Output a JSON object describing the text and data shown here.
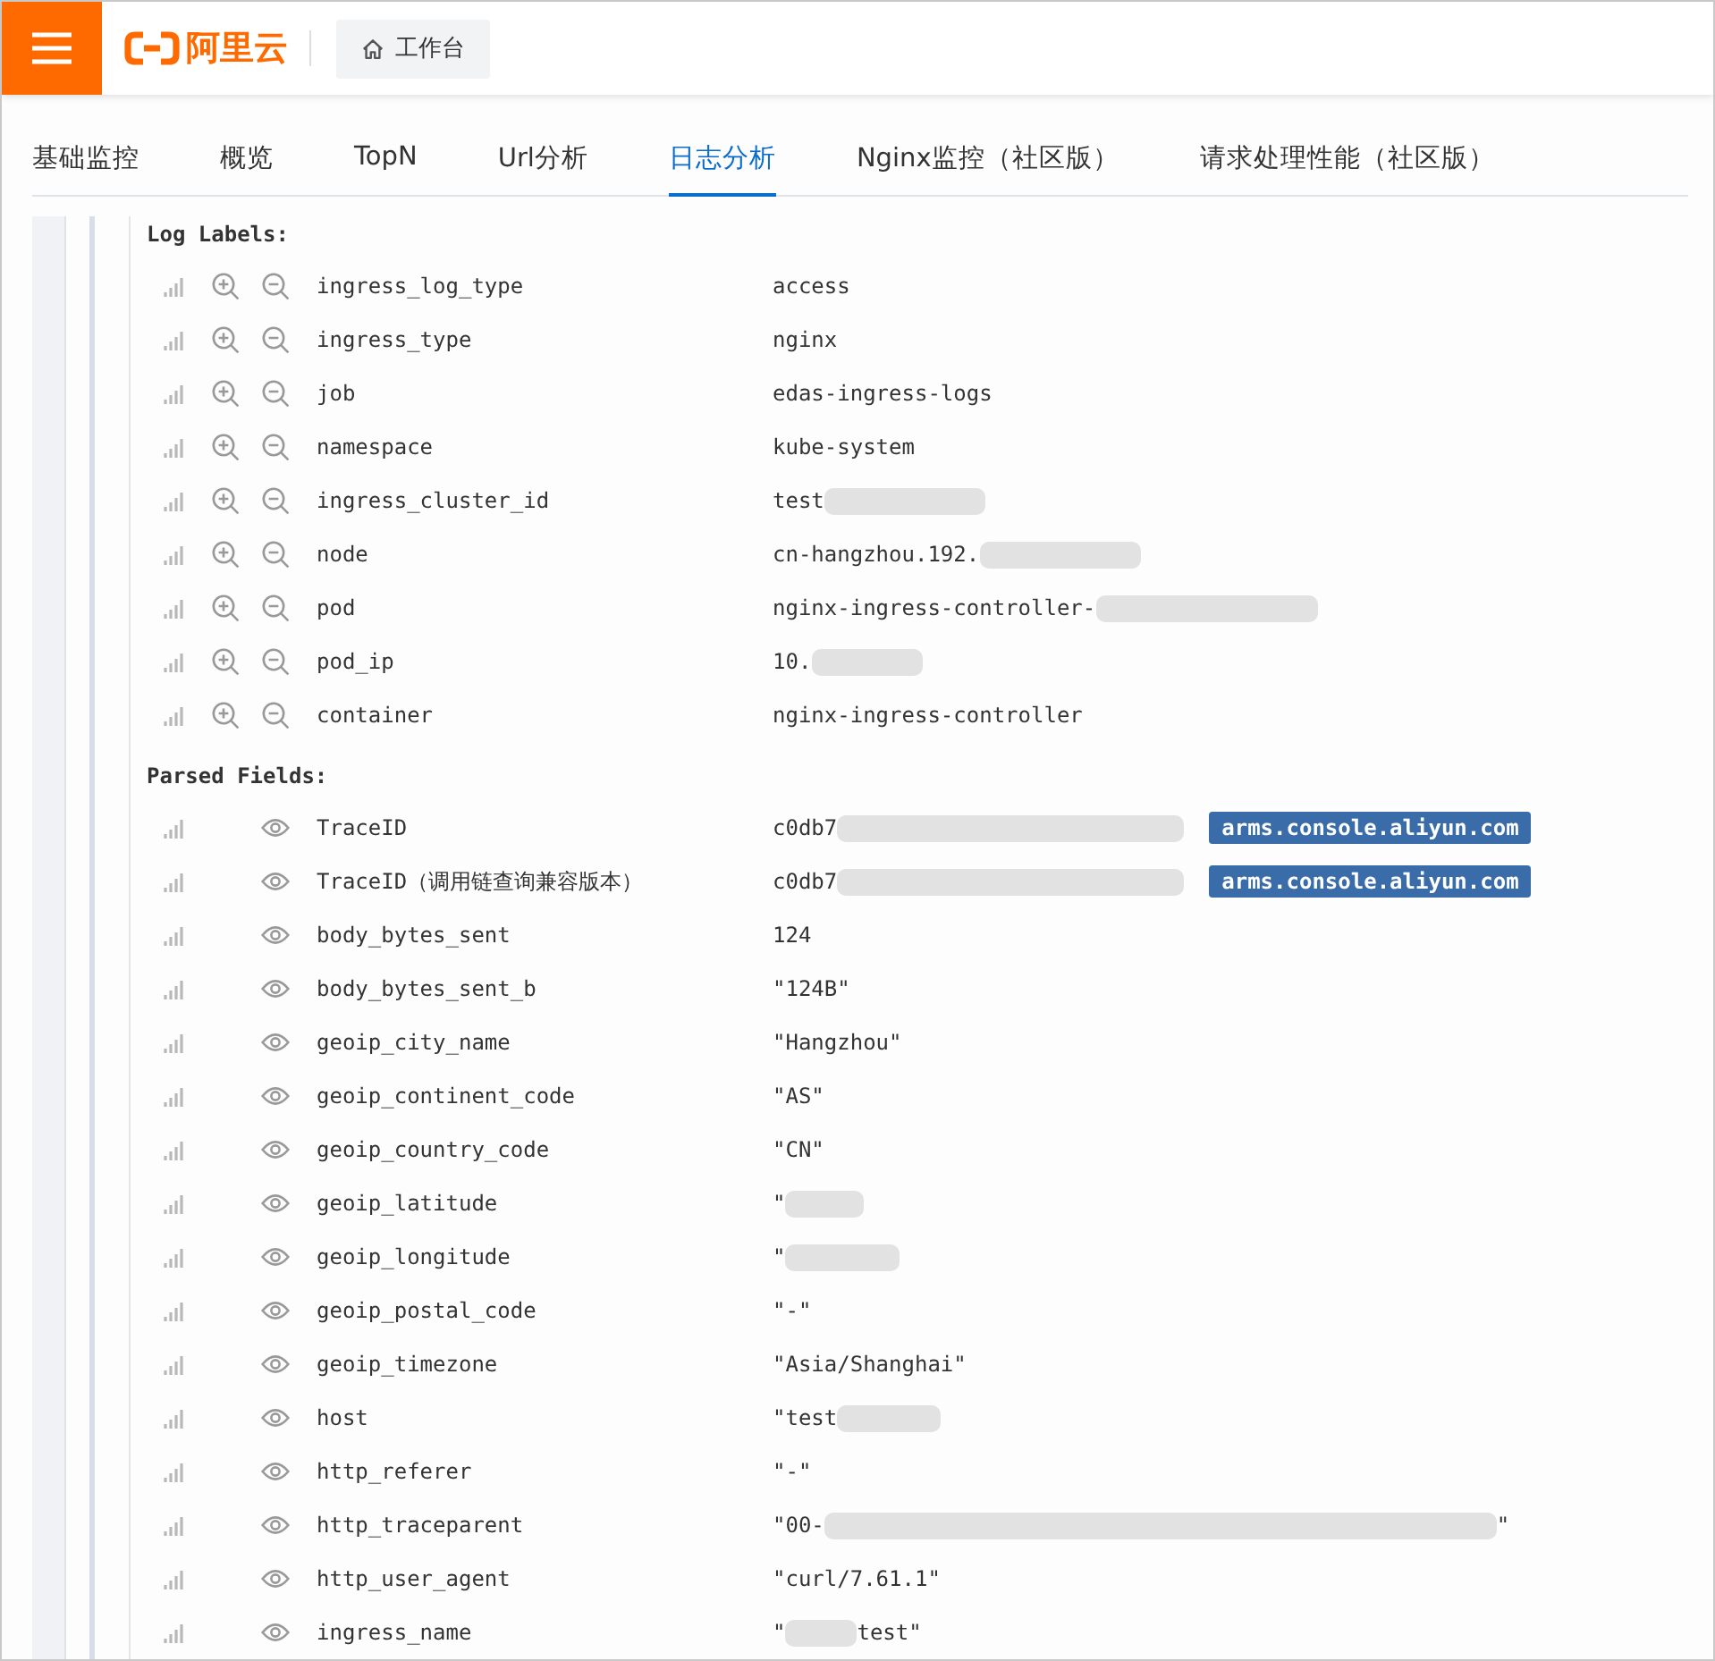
{
  "header": {
    "brand": "阿里云",
    "workspace_button": "工作台"
  },
  "tabs": [
    {
      "label": "基础监控",
      "selected": false
    },
    {
      "label": "概览",
      "selected": false
    },
    {
      "label": "TopN",
      "selected": false
    },
    {
      "label": "Url分析",
      "selected": false
    },
    {
      "label": "日志分析",
      "selected": true
    },
    {
      "label": "Nginx监控（社区版）",
      "selected": false
    },
    {
      "label": "请求处理性能（社区版）",
      "selected": false
    }
  ],
  "sections": [
    {
      "title": "Log Labels:",
      "kind": "labels",
      "rows": [
        {
          "key": "ingress_log_type",
          "value": "access",
          "redacted": false
        },
        {
          "key": "ingress_type",
          "value": "nginx",
          "redacted": false
        },
        {
          "key": "job",
          "value": "edas-ingress-logs",
          "redacted": false
        },
        {
          "key": "namespace",
          "value": "kube-system",
          "redacted": false
        },
        {
          "key": "ingress_cluster_id",
          "value": "test",
          "redacted": true
        },
        {
          "key": "node",
          "value": "cn-hangzhou.192.",
          "redacted": true
        },
        {
          "key": "pod",
          "value": "nginx-ingress-controller-",
          "redacted": true
        },
        {
          "key": "pod_ip",
          "value": "10.",
          "redacted": true
        },
        {
          "key": "container",
          "value": "nginx-ingress-controller",
          "redacted": false
        }
      ]
    },
    {
      "title": "Parsed Fields:",
      "kind": "fields",
      "rows": [
        {
          "key": "TraceID",
          "value": "c0db7",
          "redacted": true,
          "link": "arms.console.aliyun.com"
        },
        {
          "key": "TraceID（调用链查询兼容版本）",
          "value": "c0db7",
          "redacted": true,
          "link": "arms.console.aliyun.com"
        },
        {
          "key": "body_bytes_sent",
          "value": "124",
          "redacted": false
        },
        {
          "key": "body_bytes_sent_b",
          "value": "\"124B\"",
          "redacted": false
        },
        {
          "key": "geoip_city_name",
          "value": "\"Hangzhou\"",
          "redacted": false
        },
        {
          "key": "geoip_continent_code",
          "value": "\"AS\"",
          "redacted": false
        },
        {
          "key": "geoip_country_code",
          "value": "\"CN\"",
          "redacted": false
        },
        {
          "key": "geoip_latitude",
          "value": "\"",
          "redacted": true
        },
        {
          "key": "geoip_longitude",
          "value": "\"",
          "redacted": true
        },
        {
          "key": "geoip_postal_code",
          "value": "\"-\"",
          "redacted": false
        },
        {
          "key": "geoip_timezone",
          "value": "\"Asia/Shanghai\"",
          "redacted": false
        },
        {
          "key": "host",
          "value": "\"test",
          "redacted": true
        },
        {
          "key": "http_referer",
          "value": "\"-\"",
          "redacted": false
        },
        {
          "key": "http_traceparent",
          "value": "\"00-",
          "redacted": true,
          "value_end": "\""
        },
        {
          "key": "http_user_agent",
          "value": "\"curl/7.61.1\"",
          "redacted": false
        },
        {
          "key": "ingress_name",
          "value": "\"",
          "redacted": true,
          "value_end": "test\""
        }
      ]
    }
  ]
}
